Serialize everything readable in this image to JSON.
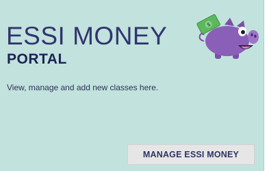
{
  "card": {
    "title": "ESSI MONEY",
    "subtitle": "PORTAL",
    "description": "View, manage and add new classes here.",
    "button_label": "MANAGE ESSI MONEY",
    "icon": "piggy-bank-money-icon"
  },
  "colors": {
    "background": "#c2e2dd",
    "title": "#31346e",
    "subtitle": "#1c2256",
    "button_bg": "#e6e6e6",
    "pig": "#8a5fb8",
    "money": "#5cb85c"
  }
}
